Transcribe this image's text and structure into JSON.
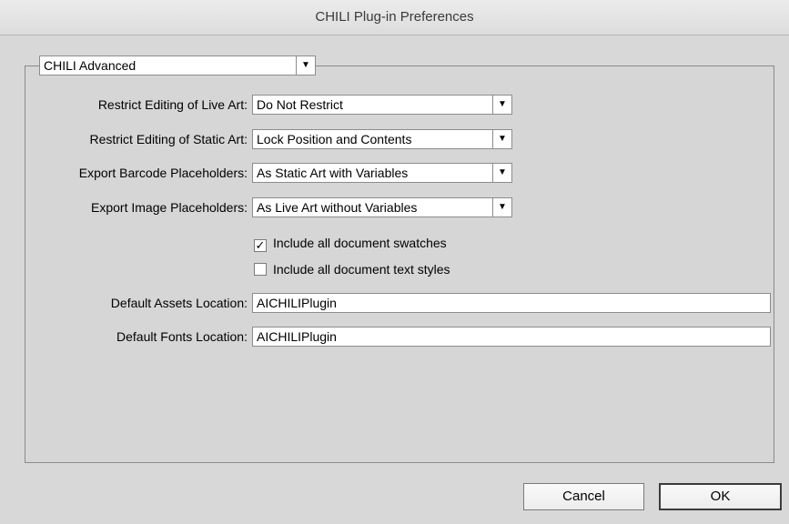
{
  "window": {
    "title": "CHILI Plug-in Preferences"
  },
  "group": {
    "selected": "CHILI Advanced"
  },
  "rows": [
    {
      "label": "Restrict Editing of Live Art:",
      "value": "Do Not Restrict"
    },
    {
      "label": "Restrict Editing of Static Art:",
      "value": "Lock Position and Contents"
    },
    {
      "label": "Export Barcode Placeholders:",
      "value": "As Static Art with Variables"
    },
    {
      "label": "Export Image Placeholders:",
      "value": "As Live Art without Variables"
    }
  ],
  "checkboxes": [
    {
      "label": "Include all document swatches",
      "checked": true
    },
    {
      "label": "Include all document text styles",
      "checked": false
    }
  ],
  "locations": [
    {
      "label": "Default Assets Location:",
      "value": "AICHILIPlugin"
    },
    {
      "label": "Default Fonts Location:",
      "value": "AICHILIPlugin"
    }
  ],
  "buttons": {
    "cancel": "Cancel",
    "ok": "OK"
  },
  "icons": {
    "dropdown": "chevron-down-icon",
    "check": "checkmark-icon"
  }
}
